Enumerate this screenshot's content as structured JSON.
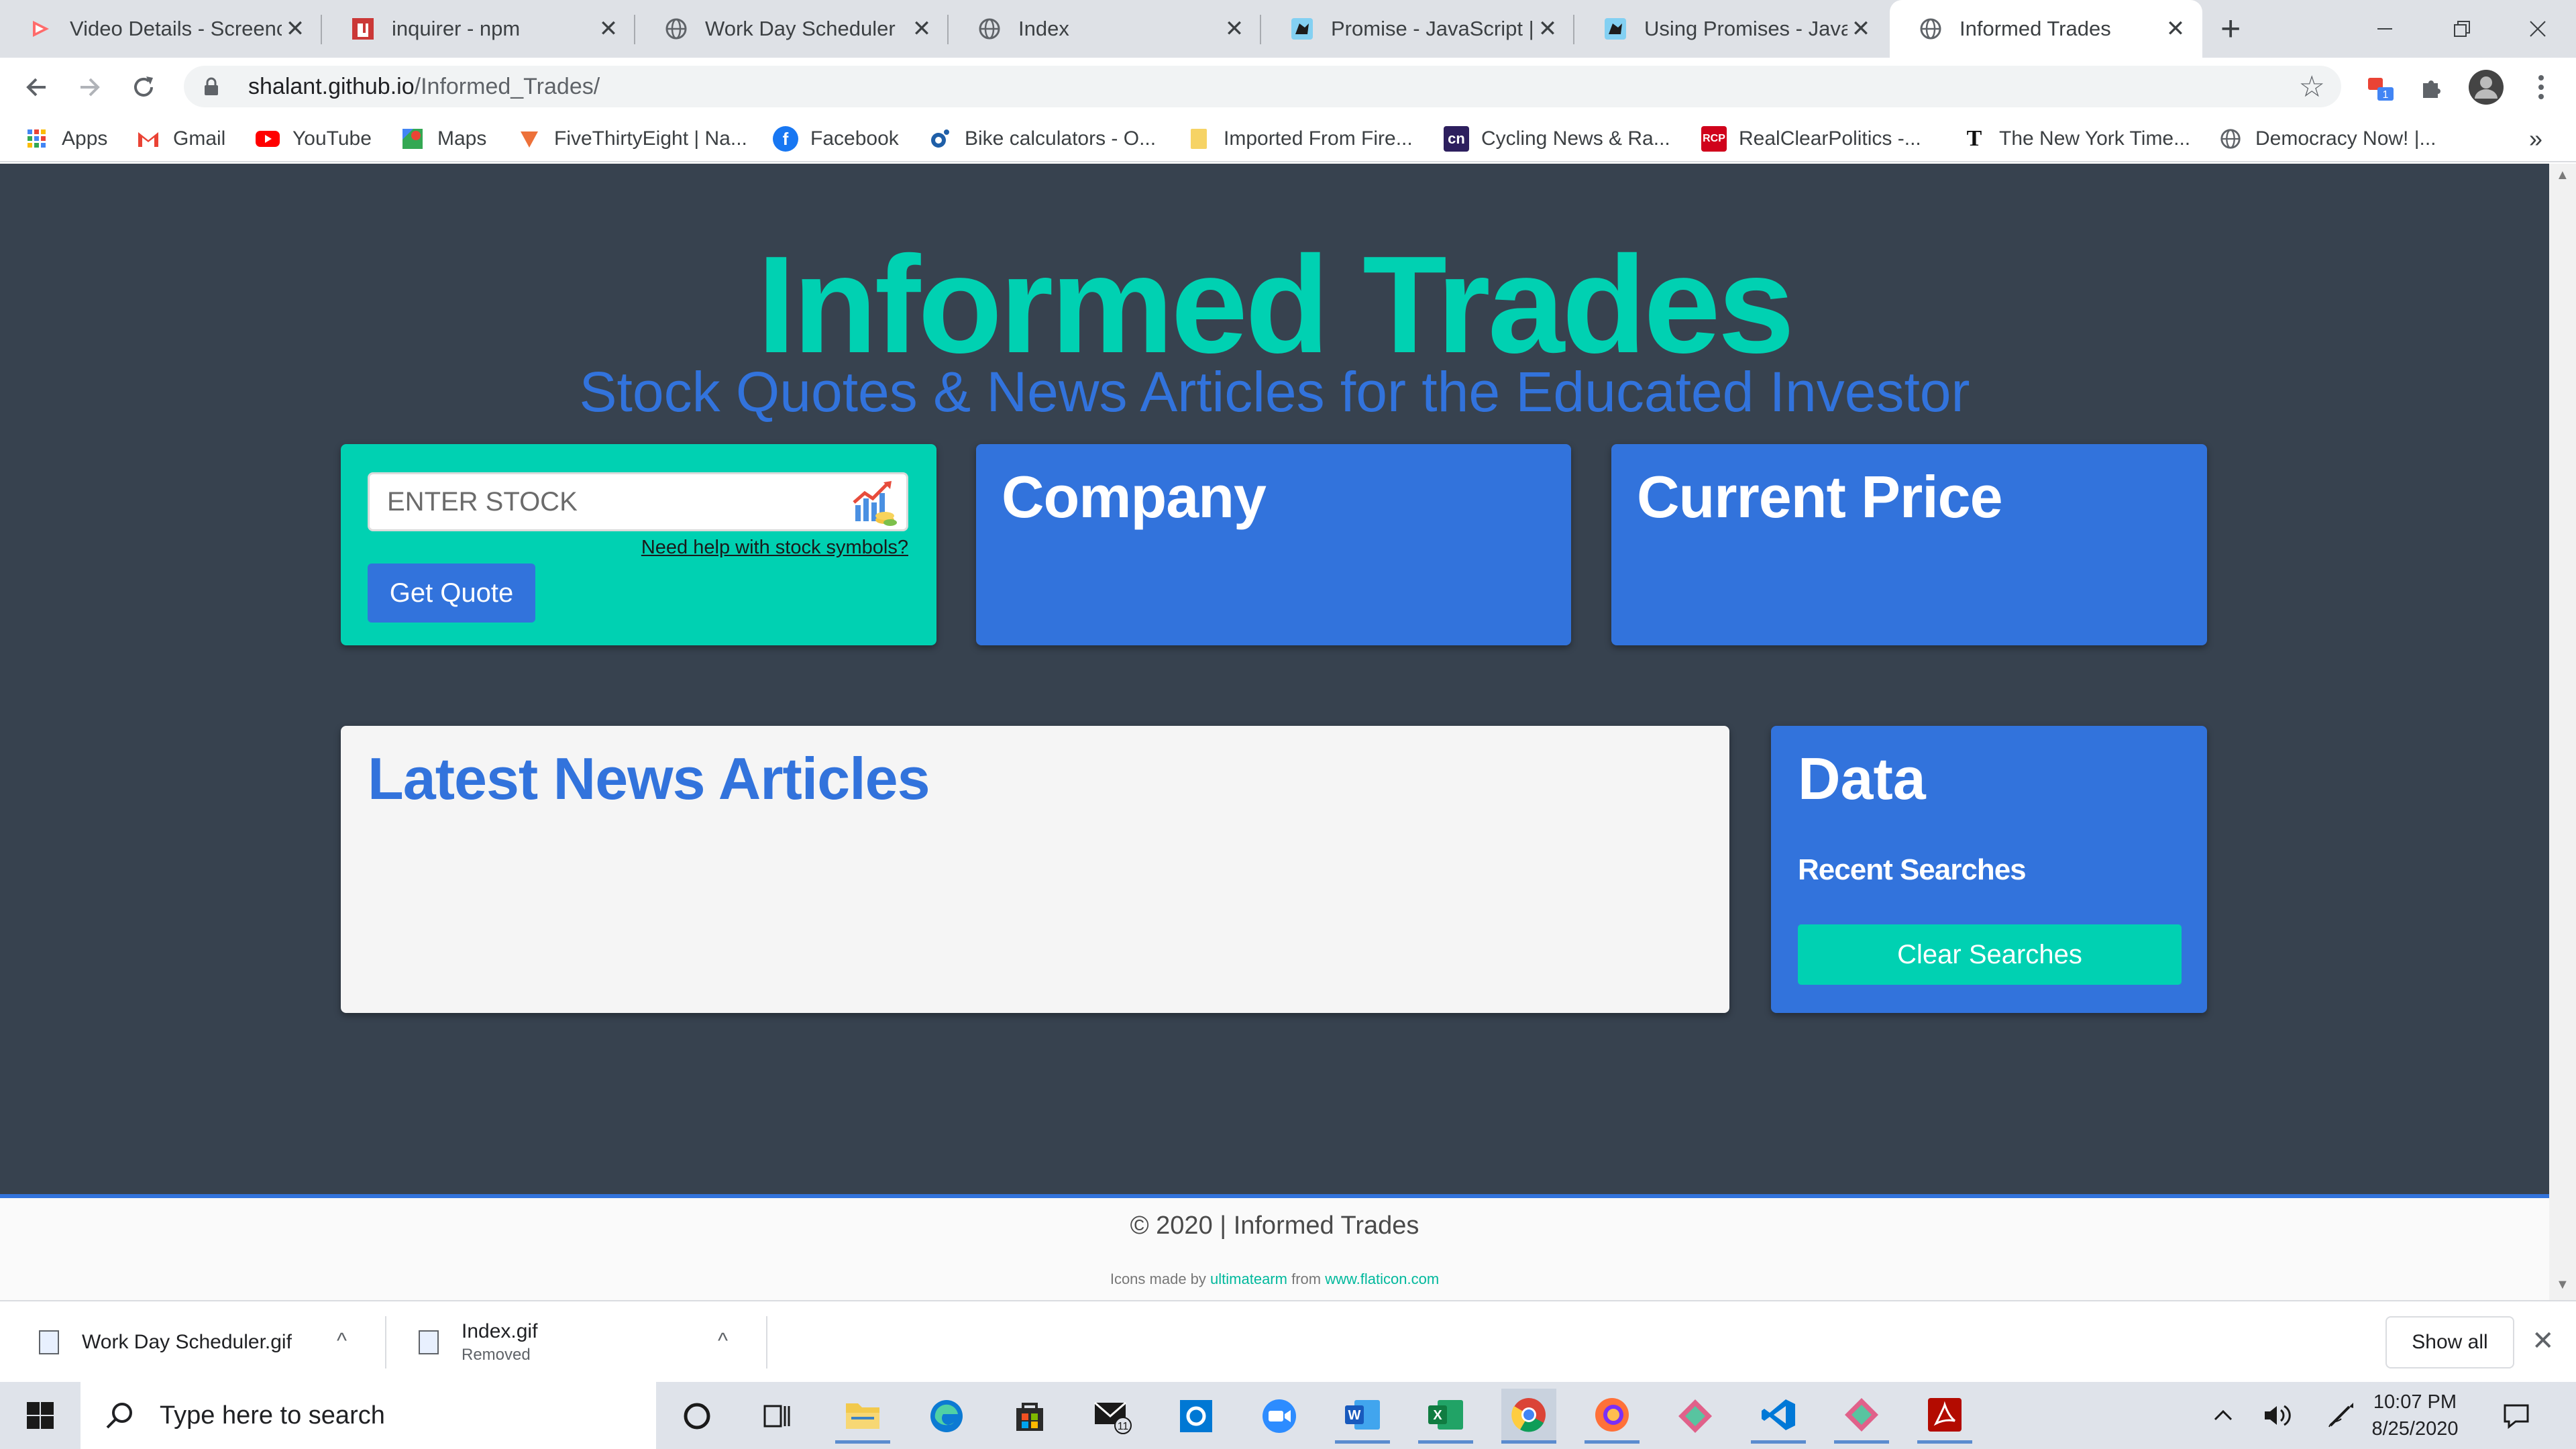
{
  "browser": {
    "tabs": [
      {
        "title": "Video Details - Screencastify",
        "icon": "screencastify-icon",
        "active": false
      },
      {
        "title": "inquirer - npm",
        "icon": "npm-icon",
        "active": false
      },
      {
        "title": "Work Day Scheduler",
        "icon": "globe-icon",
        "active": false
      },
      {
        "title": "Index",
        "icon": "globe-icon",
        "active": false
      },
      {
        "title": "Promise - JavaScript | MDN",
        "icon": "mdn-icon",
        "active": false
      },
      {
        "title": "Using Promises - JavaScript",
        "icon": "mdn-icon",
        "active": false
      },
      {
        "title": "Informed Trades",
        "icon": "globe-icon",
        "active": true
      }
    ],
    "close_glyph": "✕",
    "new_tab_glyph": "+",
    "url_host": "shalant.github.io",
    "url_path": "/Informed_Trades/",
    "extension_badge": "1",
    "bookmarks": [
      {
        "label": "Apps",
        "color": "#4285f4"
      },
      {
        "label": "Gmail",
        "color": "#ea4335"
      },
      {
        "label": "YouTube",
        "color": "#ff0000"
      },
      {
        "label": "Maps",
        "color": "#34a853"
      },
      {
        "label": "FiveThirtyEight | Na...",
        "color": "#ed713a"
      },
      {
        "label": "Facebook",
        "color": "#1877f2"
      },
      {
        "label": "Bike calculators - O...",
        "color": "#1f5fa8"
      },
      {
        "label": "Imported From Fire...",
        "color": "#f6d365"
      },
      {
        "label": "Cycling News & Ra...",
        "color": "#2d1f5e"
      },
      {
        "label": "RealClearPolitics -...",
        "color": "#d0021b"
      },
      {
        "label": "The New York Time...",
        "color": "#111111"
      },
      {
        "label": "Democracy Now! |...",
        "color": "#5f6368"
      }
    ],
    "bookmarks_overflow": "»"
  },
  "page": {
    "title": "Informed Trades",
    "subtitle": "Stock Quotes & News Articles for the Educated Investor",
    "search": {
      "placeholder": "ENTER STOCK",
      "value": "",
      "help_link": "Need help with stock symbols?",
      "button": "Get Quote"
    },
    "company_heading": "Company",
    "price_heading": "Current Price",
    "news_heading": "Latest News Articles",
    "data": {
      "heading": "Data",
      "recent_heading": "Recent Searches",
      "clear_button": "Clear Searches"
    },
    "footer": {
      "copyright": "© 2020 | Informed Trades",
      "credit_prefix": "Icons made by",
      "credit_author": "ultimatearm",
      "credit_mid": "from",
      "credit_site": "www.flaticon.com"
    },
    "colors": {
      "background": "#37424f",
      "primary": "#00d1b2",
      "link": "#3273dc",
      "light": "#f5f5f5"
    }
  },
  "downloads": {
    "items": [
      {
        "name": "Work Day Scheduler.gif",
        "status": ""
      },
      {
        "name": "Index.gif",
        "status": "Removed"
      }
    ],
    "show_all": "Show all",
    "caret_glyph": "^"
  },
  "taskbar": {
    "search_placeholder": "Type here to search",
    "mail_badge": "11",
    "time": "10:07 PM",
    "date": "8/25/2020",
    "apps": [
      "cortana-icon",
      "task-view-icon",
      "file-explorer-icon",
      "edge-icon",
      "store-icon",
      "mail-icon",
      "outlook-icon",
      "zoom-icon",
      "word-icon",
      "excel-icon",
      "chrome-icon",
      "firefox-icon",
      "gitkraken-icon",
      "vscode-icon",
      "gitkraken-icon",
      "acrobat-icon"
    ]
  }
}
